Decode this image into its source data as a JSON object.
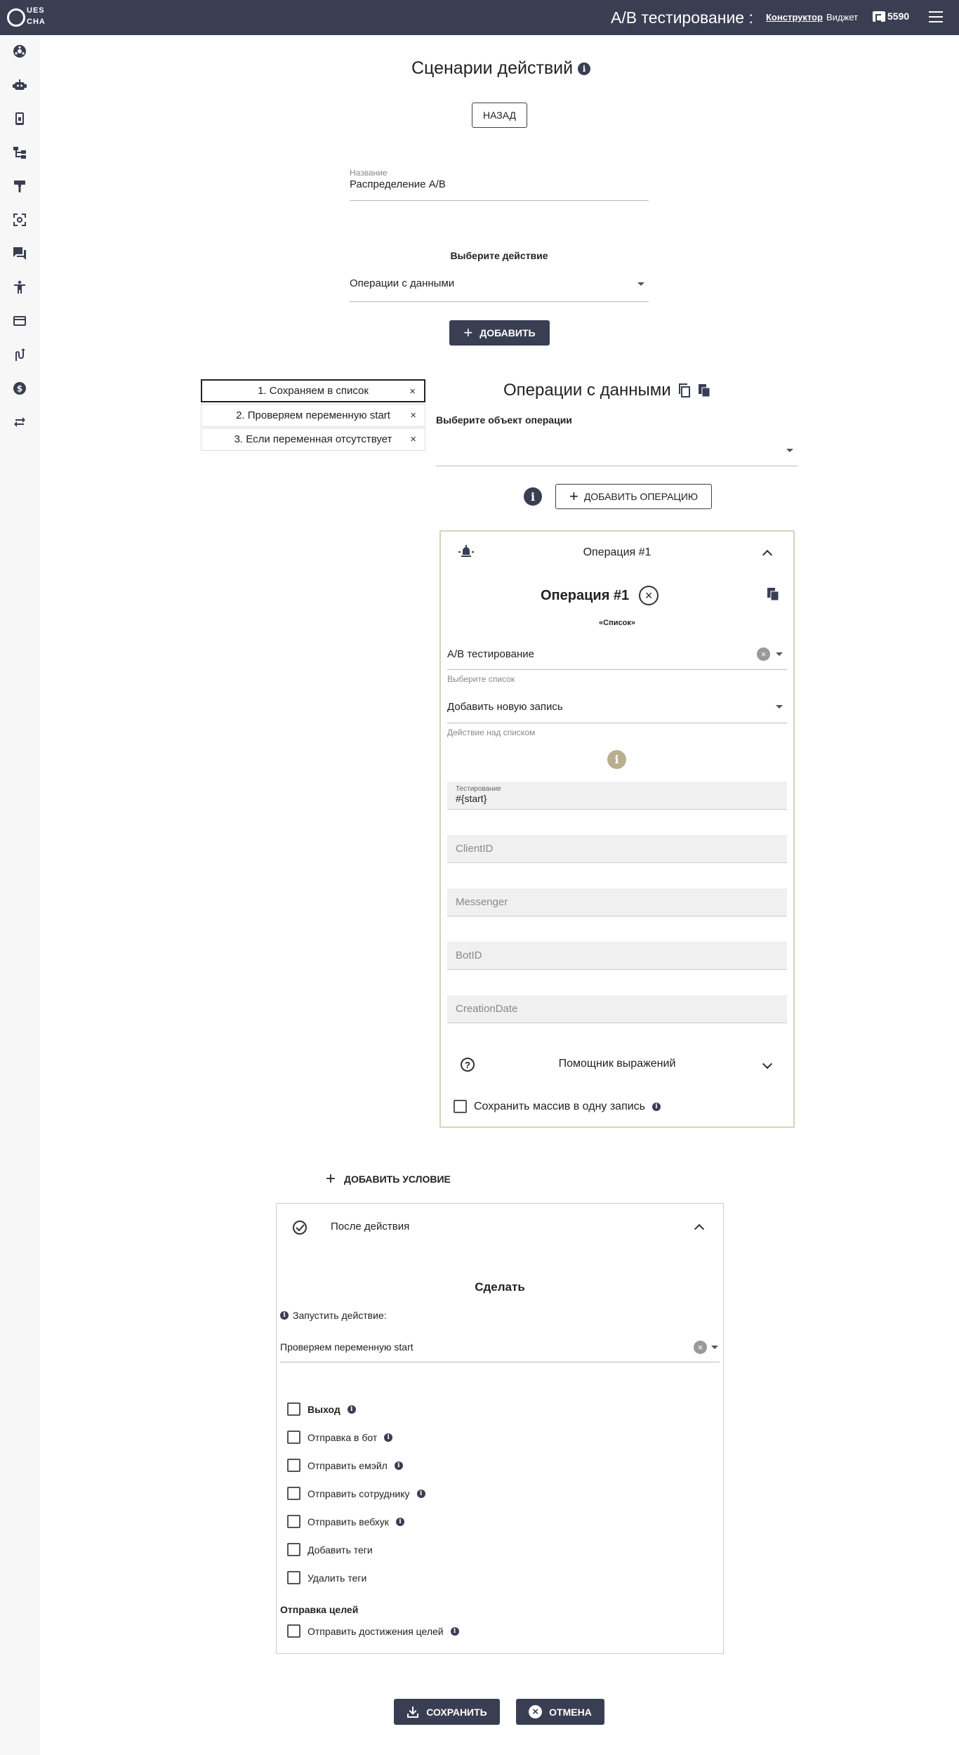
{
  "topbar": {
    "logo_top": "UES",
    "logo_bottom": "CHA",
    "title": "A/B тестирование :",
    "nav_constructor": "Конструктор",
    "nav_widget": "Виджет",
    "balance": "5590"
  },
  "page": {
    "title": "Сценарии действий",
    "back_label": "НАЗАД",
    "name_label": "Название",
    "name_value": "Распределение A/B",
    "choose_action_label": "Выберите действие",
    "action_value": "Операции с данными",
    "add_label": "ДОБАВИТЬ"
  },
  "steps": [
    {
      "label": "1. Сохраняем в список",
      "close": "×"
    },
    {
      "label": "2. Проверяем переменную start",
      "close": "×"
    },
    {
      "label": "3. Если переменная отсутствует",
      "close": "×"
    }
  ],
  "data_ops": {
    "title": "Операции с данными",
    "object_label": "Выберите объект операции",
    "add_operation_label": "ДОБАВИТЬ ОПЕРАЦИЮ",
    "operation_header": "Операция #1",
    "operation_title": "Операция #1",
    "list_caption": "«Список»",
    "list_value": "A/B тестирование",
    "list_label": "Выберите список",
    "list_action_value": "Добавить новую запись",
    "list_action_label": "Действие над списком",
    "field_testing_label": "Тестирование",
    "field_testing_value": "#{start}",
    "field_clientid": "ClientID",
    "field_messenger": "Messenger",
    "field_botid": "BotID",
    "field_creationdate": "CreationDate",
    "expression_helper": "Помощник выражений",
    "save_array_label": "Сохранить массив в одну запись"
  },
  "conditions": {
    "add_condition_label": "ДОБАВИТЬ УСЛОВИЕ",
    "after_action": "После действия",
    "do_title": "Сделать",
    "run_action_label": "Запустить действие:",
    "run_action_value": "Проверяем переменную start",
    "options": [
      {
        "label": "Выход",
        "bold": true,
        "info": true
      },
      {
        "label": "Отправка в бот",
        "bold": false,
        "info": true
      },
      {
        "label": "Отправить емэйл",
        "bold": false,
        "info": true
      },
      {
        "label": "Отправить сотруднику",
        "bold": false,
        "info": true
      },
      {
        "label": "Отправить вебхук",
        "bold": false,
        "info": true
      },
      {
        "label": "Добавить теги",
        "bold": false,
        "info": false
      },
      {
        "label": "Удалить теги",
        "bold": false,
        "info": false
      }
    ],
    "goals_title": "Отправка целей",
    "goals_option": "Отправить достижения целей"
  },
  "footer": {
    "save_label": "СОХРАНИТЬ",
    "cancel_label": "ОТМЕНА"
  },
  "colors": {
    "primary": "#3a3e52",
    "panel_border": "#d8d3b8",
    "info_muted": "#b9ae8e"
  },
  "icons": {
    "sidebar": [
      "dashboard-icon",
      "bot-icon",
      "device-icon",
      "flow-icon",
      "brush-icon",
      "scan-icon",
      "chat-icon",
      "accessibility-icon",
      "card-icon",
      "routes-icon",
      "dollar-icon",
      "swap-icon"
    ]
  }
}
